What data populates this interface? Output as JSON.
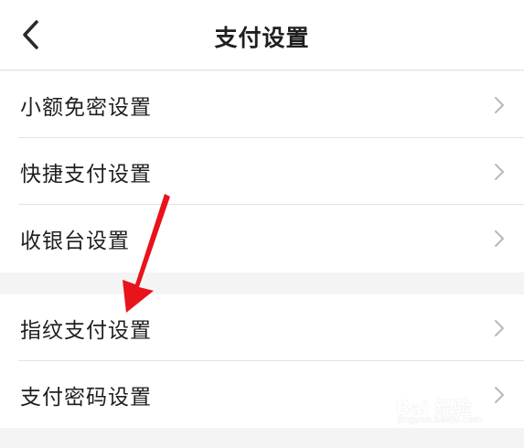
{
  "header": {
    "title": "支付设置",
    "back_icon": "chevron-left-icon"
  },
  "settings_groups": [
    {
      "items": [
        {
          "label": "小额免密设置"
        },
        {
          "label": "快捷支付设置"
        },
        {
          "label": "收银台设置"
        }
      ]
    },
    {
      "items": [
        {
          "label": "指纹支付设置"
        },
        {
          "label": "支付密码设置"
        }
      ]
    }
  ],
  "row_icon": "chevron-right-icon",
  "annotation": {
    "type": "red-arrow",
    "color": "#e8131b",
    "points_to": "指纹支付设置"
  },
  "watermark": {
    "text": "Bai 经验",
    "sub": "jingyan.baidu.com"
  },
  "colors": {
    "background": "#f4f4f4",
    "surface": "#ffffff",
    "text": "#1f1f1f",
    "chevron": "#b8b8b8",
    "divider": "#e3e3e3"
  }
}
